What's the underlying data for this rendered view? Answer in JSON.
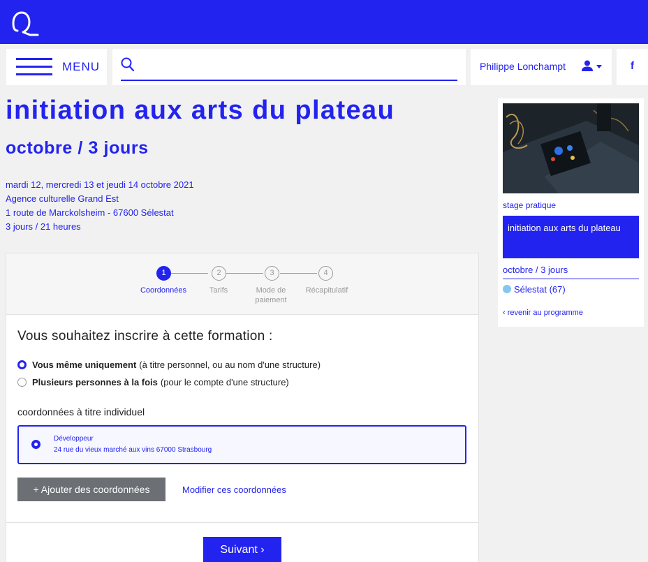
{
  "header": {
    "menu_label": "MENU",
    "search_placeholder": "",
    "user_name": "Philippe Lonchampt",
    "facebook_label": "f"
  },
  "page": {
    "title": "initiation aux arts du plateau",
    "subtitle": "octobre / 3 jours",
    "dates": "mardi 12, mercredi 13 et jeudi 14 octobre 2021",
    "venue": "Agence culturelle Grand Est",
    "address": "1 route de Marckolsheim - 67600 Sélestat",
    "duration": "3 jours / 21 heures"
  },
  "steps": [
    {
      "number": "1",
      "label": "Coordonnées",
      "active": true
    },
    {
      "number": "2",
      "label": "Tarifs",
      "active": false
    },
    {
      "number": "3",
      "label": "Mode de paiement",
      "active": false
    },
    {
      "number": "4",
      "label": "Récapitulatif",
      "active": false
    }
  ],
  "form": {
    "heading": "Vous souhaitez inscrire à cette formation :",
    "options": [
      {
        "label": "Vous même uniquement",
        "note": "(à titre personnel, ou au nom d'une structure)",
        "checked": true
      },
      {
        "label": "Plusieurs personnes à la fois",
        "note": "(pour le compte d'une structure)",
        "checked": false
      }
    ],
    "section_label": "coordonnées à titre individuel",
    "address_card": {
      "title": "Développeur",
      "line": "24 rue du vieux marché aux vins 67000 Strasbourg"
    },
    "add_button": "+ Ajouter des coordonnées",
    "edit_link": "Modifier ces coordonnées",
    "next_button": "Suivant ›"
  },
  "sidebar": {
    "tag": "stage pratique",
    "title": "initiation aux arts du plateau",
    "subtitle": "octobre / 3 jours",
    "location": "Sélestat (67)",
    "back_link": "‹ revenir au programme"
  },
  "colors": {
    "brand": "#2323f0",
    "page_background": "#f1f1f1",
    "location_dot": "#86c5f0",
    "secondary_button": "#6c6f73"
  }
}
